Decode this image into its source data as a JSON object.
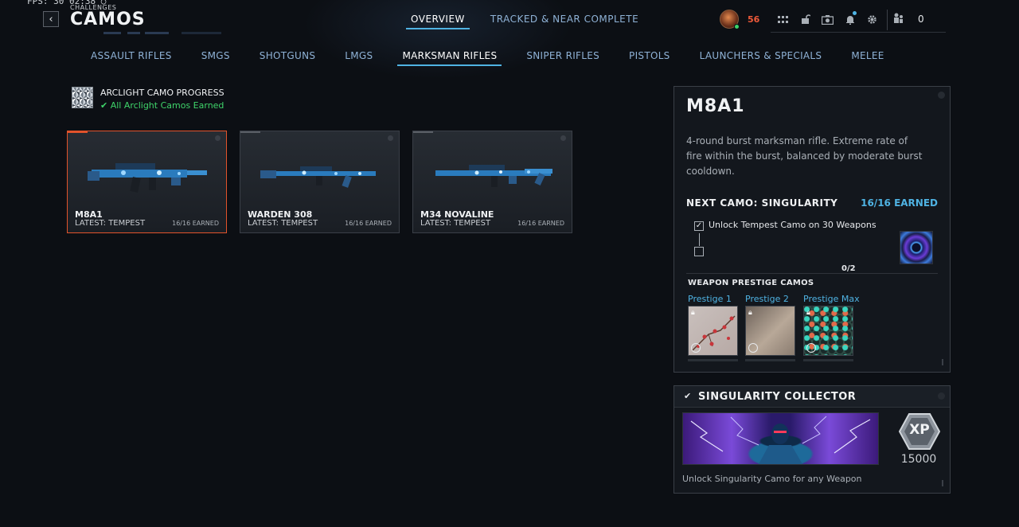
{
  "hud": {
    "fps_text": "FPS:  30  02:38  ○"
  },
  "header": {
    "breadcrumb": "CHALLENGES",
    "title": "CAMOS",
    "back_icon": "chevron-left-icon"
  },
  "top_tabs": [
    {
      "label": "OVERVIEW",
      "active": true
    },
    {
      "label": "TRACKED & NEAR COMPLETE",
      "active": false
    }
  ],
  "player": {
    "level": "56",
    "friends_count": "0",
    "icons": [
      "grid-icon",
      "unlock-icon",
      "camera-icon",
      "bell-icon",
      "gear-icon"
    ]
  },
  "category_tabs": [
    {
      "label": "ASSAULT RIFLES",
      "active": false
    },
    {
      "label": "SMGS",
      "active": false
    },
    {
      "label": "SHOTGUNS",
      "active": false
    },
    {
      "label": "LMGS",
      "active": false
    },
    {
      "label": "MARKSMAN RIFLES",
      "active": true
    },
    {
      "label": "SNIPER RIFLES",
      "active": false
    },
    {
      "label": "PISTOLS",
      "active": false
    },
    {
      "label": "LAUNCHERS & SPECIALS",
      "active": false
    },
    {
      "label": "MELEE",
      "active": false
    }
  ],
  "arclight": {
    "title": "ARCLIGHT CAMO PROGRESS",
    "status": "All Arclight Camos Earned"
  },
  "weapons": [
    {
      "name": "M8A1",
      "latest": "LATEST: TEMPEST",
      "earned": "16/16 EARNED",
      "selected": true
    },
    {
      "name": "WARDEN 308",
      "latest": "LATEST: TEMPEST",
      "earned": "16/16 EARNED",
      "selected": false
    },
    {
      "name": "M34 NOVALINE",
      "latest": "LATEST: TEMPEST",
      "earned": "16/16 EARNED",
      "selected": false
    }
  ],
  "detail": {
    "name": "M8A1",
    "description": "4-round burst marksman rifle. Extreme rate of fire within the burst, balanced by moderate burst cooldown.",
    "next_camo_label": "NEXT CAMO: SINGULARITY",
    "next_camo_earned": "16/16 EARNED",
    "task_text": "Unlock Tempest Camo on 30 Weapons",
    "task_progress": "0/2",
    "prestige_heading": "WEAPON PRESTIGE CAMOS",
    "prestige_camos": [
      {
        "label": "Prestige 1",
        "locked": true
      },
      {
        "label": "Prestige 2",
        "locked": true
      },
      {
        "label": "Prestige Max",
        "locked": true
      }
    ]
  },
  "collector": {
    "title": "SINGULARITY COLLECTOR",
    "xp_label": "XP",
    "xp_value": "15000",
    "description": "Unlock Singularity Camo for any Weapon"
  }
}
